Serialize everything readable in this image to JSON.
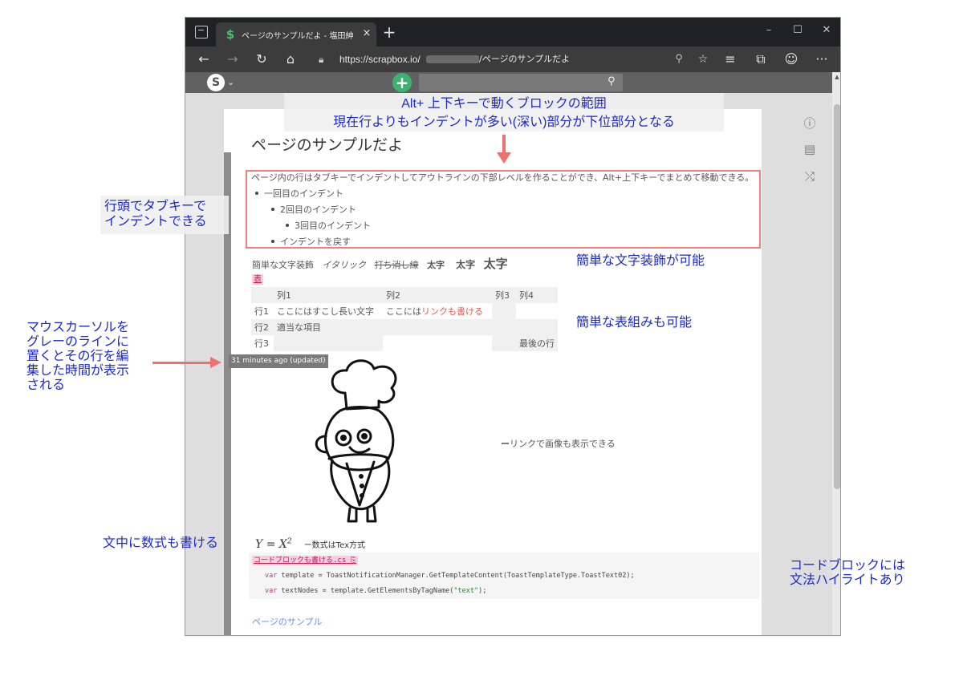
{
  "browser": {
    "tab_title": "ページのサンプルだよ - 塩田紳二のペ",
    "tab_close": "×",
    "new_tab": "+",
    "window_controls": {
      "minimize": "–",
      "maximize": "☐",
      "close": "✕"
    },
    "nav": {
      "back": "←",
      "forward": "→",
      "reload": "↻",
      "home": "⌂"
    },
    "url_protocol_host": "https://scrapbox.io/",
    "url_path": "/ページのサンプルだよ",
    "icons": [
      "lock-icon",
      "zoom-icon",
      "favorite-add-icon",
      "favorites-icon",
      "collections-icon",
      "profile-icon",
      "more-icon"
    ],
    "more_label": "···"
  },
  "app": {
    "logo_glyph": "S",
    "caret": "⌄",
    "new_page": "+",
    "search_glyph": "⚲"
  },
  "page": {
    "title": "ページのサンプルだよ",
    "intro": "ページ内の行はタブキーでインデントしてアウトラインの下部レベルを作ることができ、Alt+上下キーでまとめて移動できる。",
    "outline": [
      {
        "level": 1,
        "text": "一回目のインデント"
      },
      {
        "level": 2,
        "text": "2回目のインデント"
      },
      {
        "level": 3,
        "text": "3回目のインデント"
      },
      {
        "level": 2,
        "text": "インデントを戻す"
      }
    ],
    "decoration": {
      "plain": "簡単な文字装飾",
      "italic": "イタリック",
      "strike": "打ち消し線",
      "bold1": "太字",
      "bold2": "太字",
      "bold3": "太字"
    },
    "table_label": "表",
    "table": {
      "header": [
        "",
        "列1",
        "列2",
        "列3",
        "列4"
      ],
      "rows": [
        [
          "行1",
          "ここにはすこし長い文字",
          "ここには",
          "リンクも書ける",
          "",
          ""
        ],
        [
          "行2",
          "適当な項目",
          "",
          "",
          "",
          ""
        ],
        [
          "行3",
          "",
          "",
          "",
          "最後の行",
          ""
        ]
      ]
    },
    "tooltip": "31 minutes ago (updated)",
    "image_caption_dash": "ー",
    "image_caption": "リンクで画像も表示できる",
    "math_y": "Y",
    "math_eq": " = ",
    "math_x": "X",
    "math_exp": "2",
    "math_note": "ー数式はTex方式",
    "code_label": "コードブロックも書ける.cs",
    "code_lines": [
      {
        "kw": "var",
        "rest": " template = ToastNotificationManager.GetTemplateContent(ToastTemplateType.ToastText02);"
      },
      {
        "kw": "var",
        "rest": " textNodes = template.GetElementsByTagName(",
        "str": "\"text\"",
        "tail": ");"
      }
    ],
    "related_link": "ページのサンプル"
  },
  "side_icons": [
    "info-icon",
    "document-icon",
    "shuffle-icon"
  ],
  "annotations": {
    "top_line1": "Alt+ 上下キーで動くブロックの範囲",
    "top_line2": "現在行よりもインデントが多い(深い)部分が下位部分となる",
    "indent_note": [
      "行頭でタブキーで",
      "インデントできる"
    ],
    "deco_note": "簡単な文字装飾が可能",
    "table_note": "簡単な表組みも可能",
    "mouse_note": [
      "マウスカーソルを",
      "グレーのラインに",
      "置くとその行を編",
      "集した時間が表示",
      "される"
    ],
    "math_note_ann": "文中に数式も書ける",
    "code_note": [
      "コードブロックには",
      "文法ハイライトあり"
    ]
  },
  "colors": {
    "annotation_text": "#1d29c9",
    "annotation_marker": "#f07070",
    "link": "#e55a4a",
    "related_link": "#6495ed",
    "new_button": "#3cb371"
  }
}
